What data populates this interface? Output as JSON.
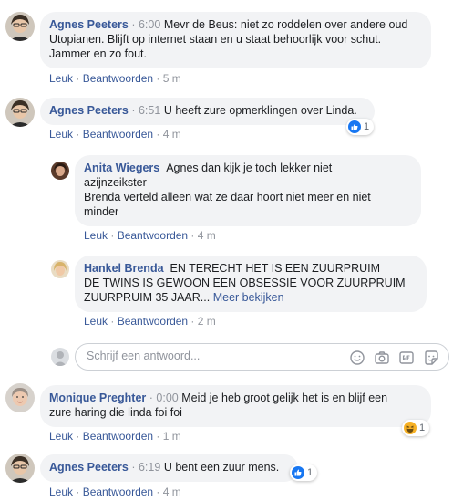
{
  "comments": [
    {
      "author": "Agnes Peeters",
      "time": "6:00",
      "lines": [
        "Mevr de Beus: niet zo roddelen over andere oud",
        "Utopianen. Blijft op internet staan en u staat behoorlijk voor schut.",
        "Jammer en zo fout."
      ],
      "like": "Leuk",
      "reply": "Beantwoorden",
      "age": "5 m"
    },
    {
      "author": "Agnes Peeters",
      "time": "6:51",
      "lines": [
        "U heeft zure opmerklingen over Linda."
      ],
      "like": "Leuk",
      "reply": "Beantwoorden",
      "age": "4 m",
      "reaction": {
        "type": "like",
        "count": "1"
      }
    },
    {
      "author": "Monique Preghter",
      "time": "0:00",
      "lines": [
        "Meid je heb groot gelijk het is en blijf een",
        "zure haring die linda foi foi"
      ],
      "like": "Leuk",
      "reply": "Beantwoorden",
      "age": "1 m",
      "reaction": {
        "type": "haha",
        "count": "1"
      }
    },
    {
      "author": "Agnes Peeters",
      "time": "6:19",
      "lines": [
        "U bent een zuur mens."
      ],
      "like": "Leuk",
      "reply": "Beantwoorden",
      "age": "4 m",
      "reaction": {
        "type": "like",
        "count": "1"
      }
    }
  ],
  "replies": [
    {
      "author": "Anita Wiegers",
      "lines": [
        "Agnes dan kijk je toch lekker niet",
        "azijnzeikster",
        "Brenda verteld alleen wat ze daar hoort niet meer en niet",
        "minder"
      ],
      "like": "Leuk",
      "reply": "Beantwoorden",
      "age": "4 m"
    },
    {
      "author": "Hankel Brenda",
      "lines": [
        "EN TERECHT HET IS EEN ZUURPRUIM",
        "DE TWINS IS GEWOON EEN OBSESSIE VOOR ZUURPRUIM",
        "ZUURPRUIM 35 JAAR..."
      ],
      "more": "Meer bekijken",
      "like": "Leuk",
      "reply": "Beantwoorden",
      "age": "2 m"
    }
  ],
  "reply_box": {
    "placeholder": "Schrijf een antwoord..."
  },
  "icons": {
    "reply_box": [
      "smiley-icon",
      "camera-icon",
      "gif-icon",
      "sticker-icon"
    ],
    "reactions": [
      "like-icon",
      "haha-icon"
    ]
  },
  "colors": {
    "author": "#385898",
    "meta": "#90949c",
    "bubble": "#f2f3f5",
    "like": "#1877f2",
    "haha": "#f7b125"
  }
}
